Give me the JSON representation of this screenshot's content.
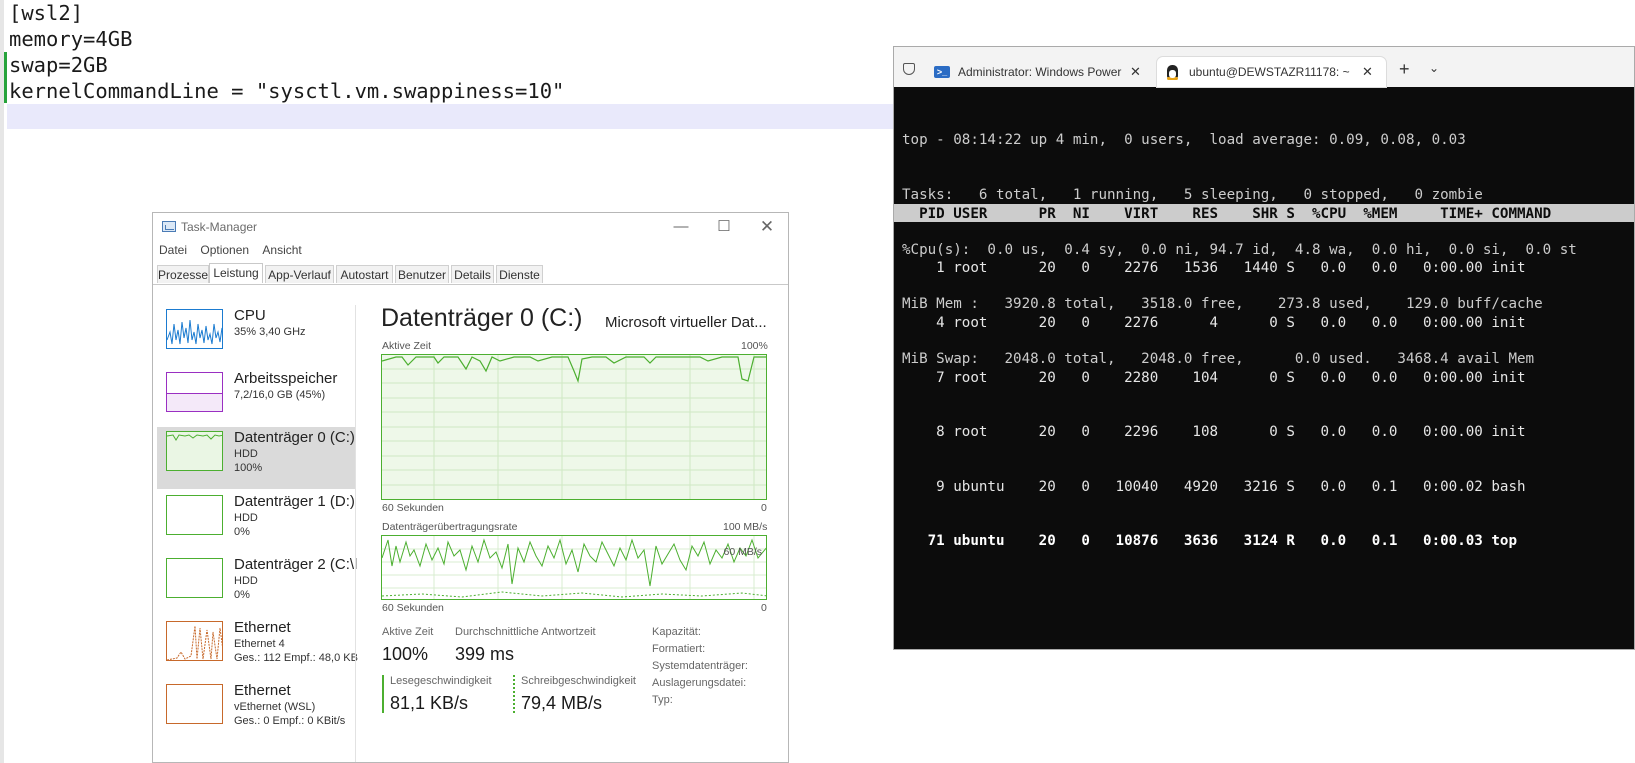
{
  "editor": {
    "lines": [
      "[wsl2]",
      "memory=4GB",
      "swap=2GB",
      "kernelCommandLine = \"sysctl.vm.swappiness=10\""
    ]
  },
  "taskmanager": {
    "title": "Task-Manager",
    "menu": [
      "Datei",
      "Optionen",
      "Ansicht"
    ],
    "tabs": [
      "Prozesse",
      "Leistung",
      "App-Verlauf",
      "Autostart",
      "Benutzer",
      "Details",
      "Dienste"
    ],
    "active_tab": "Leistung",
    "sidebar": [
      {
        "name": "CPU",
        "sub1": "35% 3,40 GHz",
        "sub2": ""
      },
      {
        "name": "Arbeitsspeicher",
        "sub1": "7,2/16,0 GB (45%)",
        "sub2": ""
      },
      {
        "name": "Datenträger 0 (C:)",
        "sub1": "HDD",
        "sub2": "100%"
      },
      {
        "name": "Datenträger 1 (D:)",
        "sub1": "HDD",
        "sub2": "0%"
      },
      {
        "name": "Datenträger 2 (C:\\l",
        "sub1": "HDD",
        "sub2": "0%"
      },
      {
        "name": "Ethernet",
        "sub1": "Ethernet 4",
        "sub2": "Ges.: 112  Empf.: 48,0 KB"
      },
      {
        "name": "Ethernet",
        "sub1": "vEthernet (WSL)",
        "sub2": "Ges.: 0  Empf.: 0 KBit/s"
      }
    ],
    "main": {
      "title": "Datenträger 0 (C:)",
      "model": "Microsoft virtueller Dat...",
      "graph1": {
        "label": "Aktive Zeit",
        "max": "100%",
        "time": "60 Sekunden",
        "min": "0"
      },
      "graph2": {
        "label": "Datenträgerübertragungsrate",
        "max": "100 MB/s",
        "inner": "60 MB/s",
        "time": "60 Sekunden",
        "min": "0"
      },
      "stats": {
        "active_label": "Aktive Zeit",
        "active_value": "100%",
        "resp_label": "Durchschnittliche Antwortzeit",
        "resp_value": "399 ms",
        "read_label": "Lesegeschwindigkeit",
        "read_value": "81,1 KB/s",
        "write_label": "Schreibgeschwindigkeit",
        "write_value": "79,4 MB/s"
      },
      "props": [
        "Kapazität:",
        "Formatiert:",
        "Systemdatenträger:",
        "Auslagerungsdatei:",
        "Typ:"
      ]
    }
  },
  "terminal": {
    "tabs": [
      {
        "label": "Administrator: Windows Power",
        "icon": "powershell-icon",
        "active": false
      },
      {
        "label": "ubuntu@DEWSTAZR11178: ~",
        "icon": "tux-icon",
        "active": true
      }
    ],
    "top_lines": [
      "top - 08:14:22 up 4 min,  0 users,  load average: 0.09, 0.08, 0.03",
      "Tasks:   6 total,   1 running,   5 sleeping,   0 stopped,   0 zombie",
      "%Cpu(s):  0.0 us,  0.4 sy,  0.0 ni, 94.7 id,  4.8 wa,  0.0 hi,  0.0 si,  0.0 st",
      "MiB Mem :   3920.8 total,   3518.0 free,    273.8 used,    129.0 buff/cache",
      "MiB Swap:   2048.0 total,   2048.0 free,      0.0 used.   3468.4 avail Mem"
    ],
    "header": "  PID USER      PR  NI    VIRT    RES    SHR S  %CPU  %MEM     TIME+ COMMAND",
    "processes": [
      "    1 root      20   0    2276   1536   1440 S   0.0   0.0   0:00.00 init",
      "    4 root      20   0    2276      4      0 S   0.0   0.0   0:00.00 init",
      "    7 root      20   0    2280    104      0 S   0.0   0.0   0:00.00 init",
      "    8 root      20   0    2296    108      0 S   0.0   0.0   0:00.00 init",
      "    9 ubuntu    20   0   10040   4920   3216 S   0.0   0.1   0:00.02 bash",
      "   71 ubuntu    20   0   10876   3636   3124 R   0.0   0.1   0:00.03 top"
    ]
  }
}
